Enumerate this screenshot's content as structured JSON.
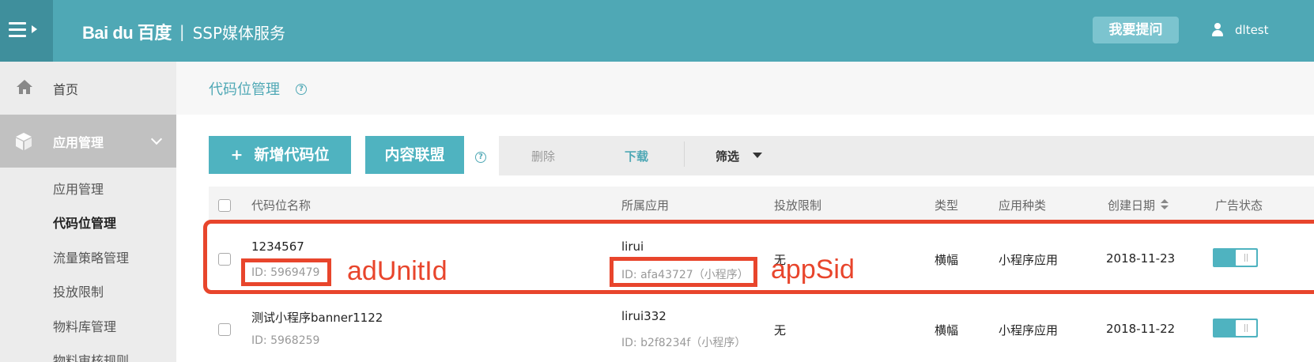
{
  "header": {
    "logo_text": "Bai du 百度",
    "separator": "|",
    "product": "SSP媒体服务",
    "ask_button": "我要提问",
    "username": "dltest"
  },
  "sidebar": {
    "home": "首页",
    "app_management": "应用管理",
    "sub_items": [
      "应用管理",
      "代码位管理",
      "流量策略管理",
      "投放限制",
      "物料库管理",
      "物料审核规则"
    ]
  },
  "main": {
    "page_title": "代码位管理",
    "toolbar": {
      "new_button": "新增代码位",
      "content_button": "内容联盟",
      "delete": "删除",
      "download": "下载",
      "filter": "筛选"
    },
    "table": {
      "headers": [
        "代码位名称",
        "所属应用",
        "投放限制",
        "类型",
        "应用种类",
        "创建日期",
        "广告状态"
      ],
      "rows": [
        {
          "name": "1234567",
          "id": "ID: 5969479",
          "app": "lirui",
          "app_id": "ID: afa43727（小程序）",
          "limit": "无",
          "type": "横幅",
          "app_kind": "小程序应用",
          "date": "2018-11-23",
          "status_on": true
        },
        {
          "name": "测试小程序banner1122",
          "id": "ID: 5968259",
          "app": "lirui332",
          "app_id": "ID: b2f8234f（小程序）",
          "limit": "无",
          "type": "横幅",
          "app_kind": "小程序应用",
          "date": "2018-11-22",
          "status_on": true
        }
      ]
    }
  },
  "annotations": {
    "left_label": "adUnitId",
    "right_label": "appSid",
    "color": "#e8452c"
  },
  "colors": {
    "header": "#4fa8b5",
    "accent": "#4fb3c0"
  }
}
